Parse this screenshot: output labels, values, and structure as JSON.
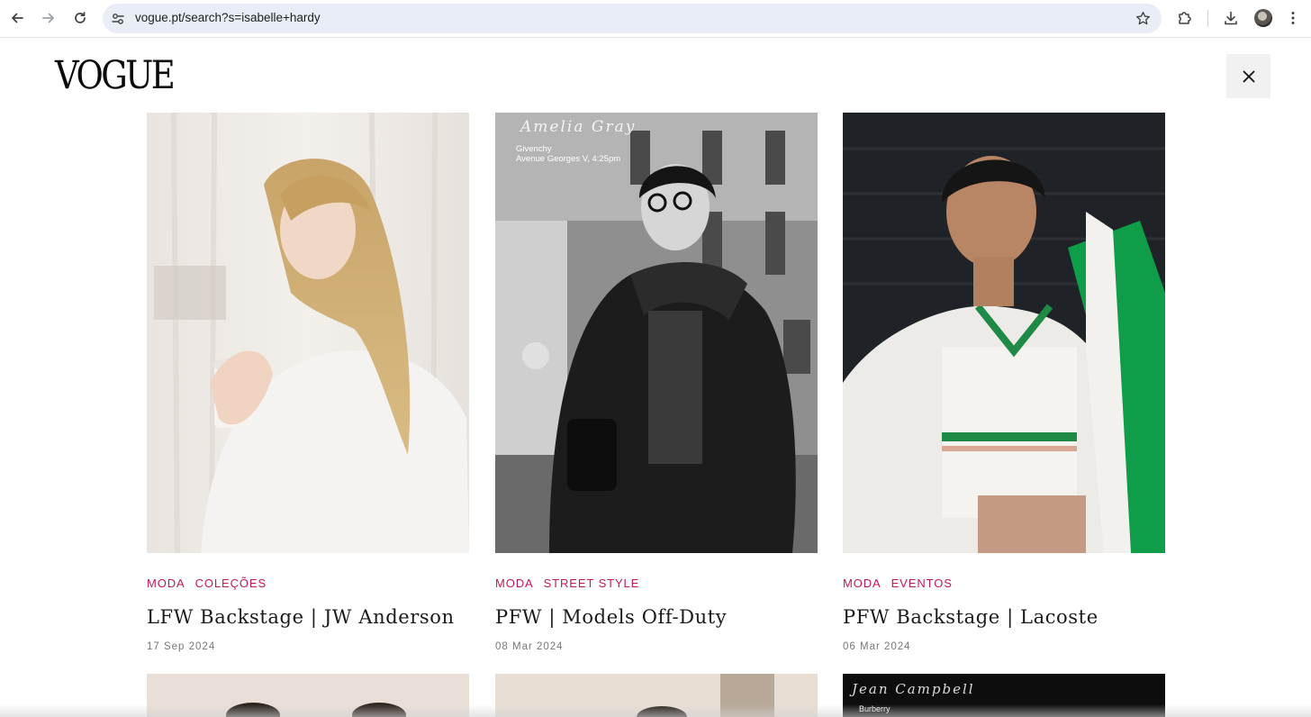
{
  "browser": {
    "url": "vogue.pt/search?s=isabelle+hardy",
    "icons": [
      "back-arrow-icon",
      "forward-arrow-icon",
      "reload-icon",
      "site-settings-icon",
      "bookmark-star-icon",
      "extensions-icon",
      "download-icon",
      "profile-avatar",
      "more-menu-icon"
    ]
  },
  "header": {
    "logo": "VOGUE",
    "close_icon": "close-icon"
  },
  "results": [
    {
      "categories": [
        "MODA",
        "COLEÇÕES"
      ],
      "title": "LFW Backstage | JW Anderson",
      "date": "17 Sep 2024"
    },
    {
      "categories": [
        "MODA",
        "STREET STYLE"
      ],
      "title": "PFW | Models Off-Duty",
      "date": "08 Mar 2024",
      "overlay": {
        "script": "Amelia Gray",
        "line1": "Givenchy",
        "line2": "Avenue Georges V, 4:25pm"
      }
    },
    {
      "categories": [
        "MODA",
        "EVENTOS"
      ],
      "title": "PFW Backstage | Lacoste",
      "date": "06 Mar 2024"
    }
  ],
  "next_row": [
    {},
    {},
    {
      "overlay": {
        "script": "Jean Campbell",
        "line1": "Burberry"
      }
    }
  ],
  "colors": {
    "category": "#c2185b",
    "omnibox": "#e9eef6"
  }
}
